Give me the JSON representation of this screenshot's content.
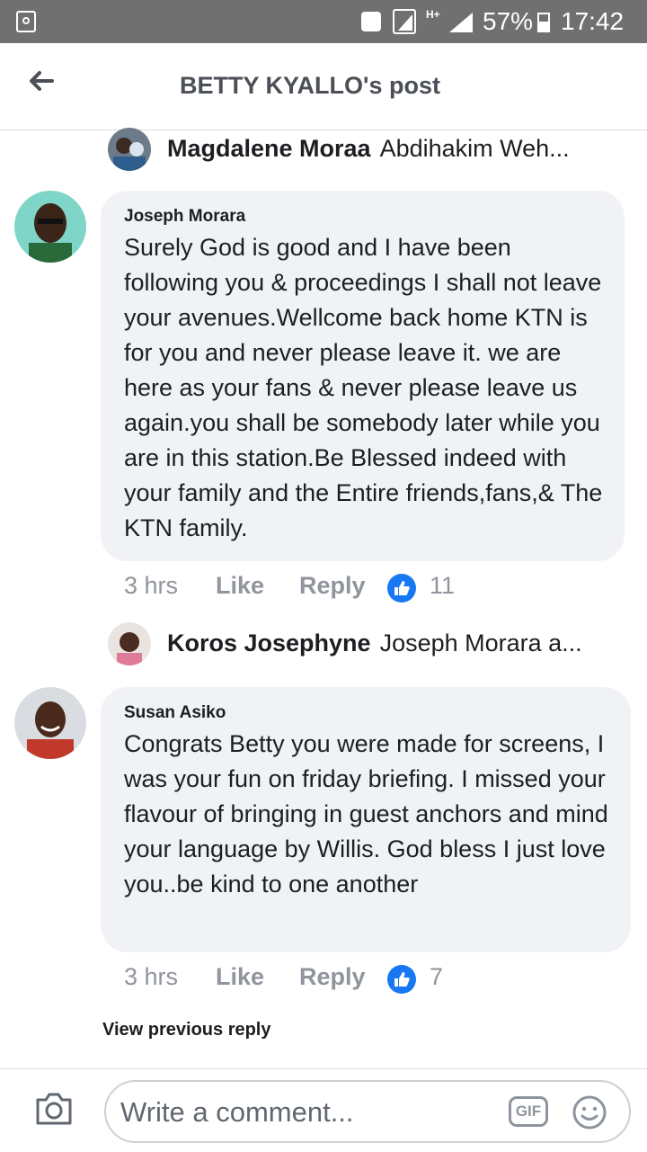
{
  "status_bar": {
    "network": "H+",
    "battery": "57%",
    "time": "17:42"
  },
  "header": {
    "title": "BETTY KYALLO's post"
  },
  "replies": [
    {
      "name": "Magdalene Moraa",
      "snippet": "Abdihakim Weh..."
    },
    {
      "name": "Koros Josephyne",
      "snippet": "Joseph Morara a..."
    }
  ],
  "comments": [
    {
      "author": "Joseph Morara",
      "text": "Surely God is good and I have been following you & proceedings I shall not leave your avenues.Wellcome back home KTN is for you and never please leave it. we are here as your fans & never please leave us again.you shall be  somebody later while you are in this station.Be Blessed indeed with your family and the Entire friends,fans,& The KTN family.",
      "time": "3 hrs",
      "like_label": "Like",
      "reply_label": "Reply",
      "likes": "11"
    },
    {
      "author": "Susan Asiko",
      "text": "Congrats Betty you were made for screens, I was your fun on friday briefing. I missed your  flavour of bringing in guest anchors and mind your language by Willis. God bless I just love you..be kind to one another",
      "time": "3 hrs",
      "like_label": "Like",
      "reply_label": "Reply",
      "likes": "7"
    }
  ],
  "view_previous_reply": "View previous reply",
  "composer": {
    "placeholder": "Write a comment...",
    "gif_label": "GIF"
  },
  "colors": {
    "status_bar": "#707070",
    "bubble": "#f0f2f5",
    "like_blue": "#1877f2",
    "meta_gray": "#90949c"
  },
  "icons": [
    "back-arrow-icon",
    "camera-icon",
    "gif-icon",
    "emoji-icon",
    "like-icon",
    "phone-icon",
    "signal-icon",
    "battery-icon"
  ]
}
